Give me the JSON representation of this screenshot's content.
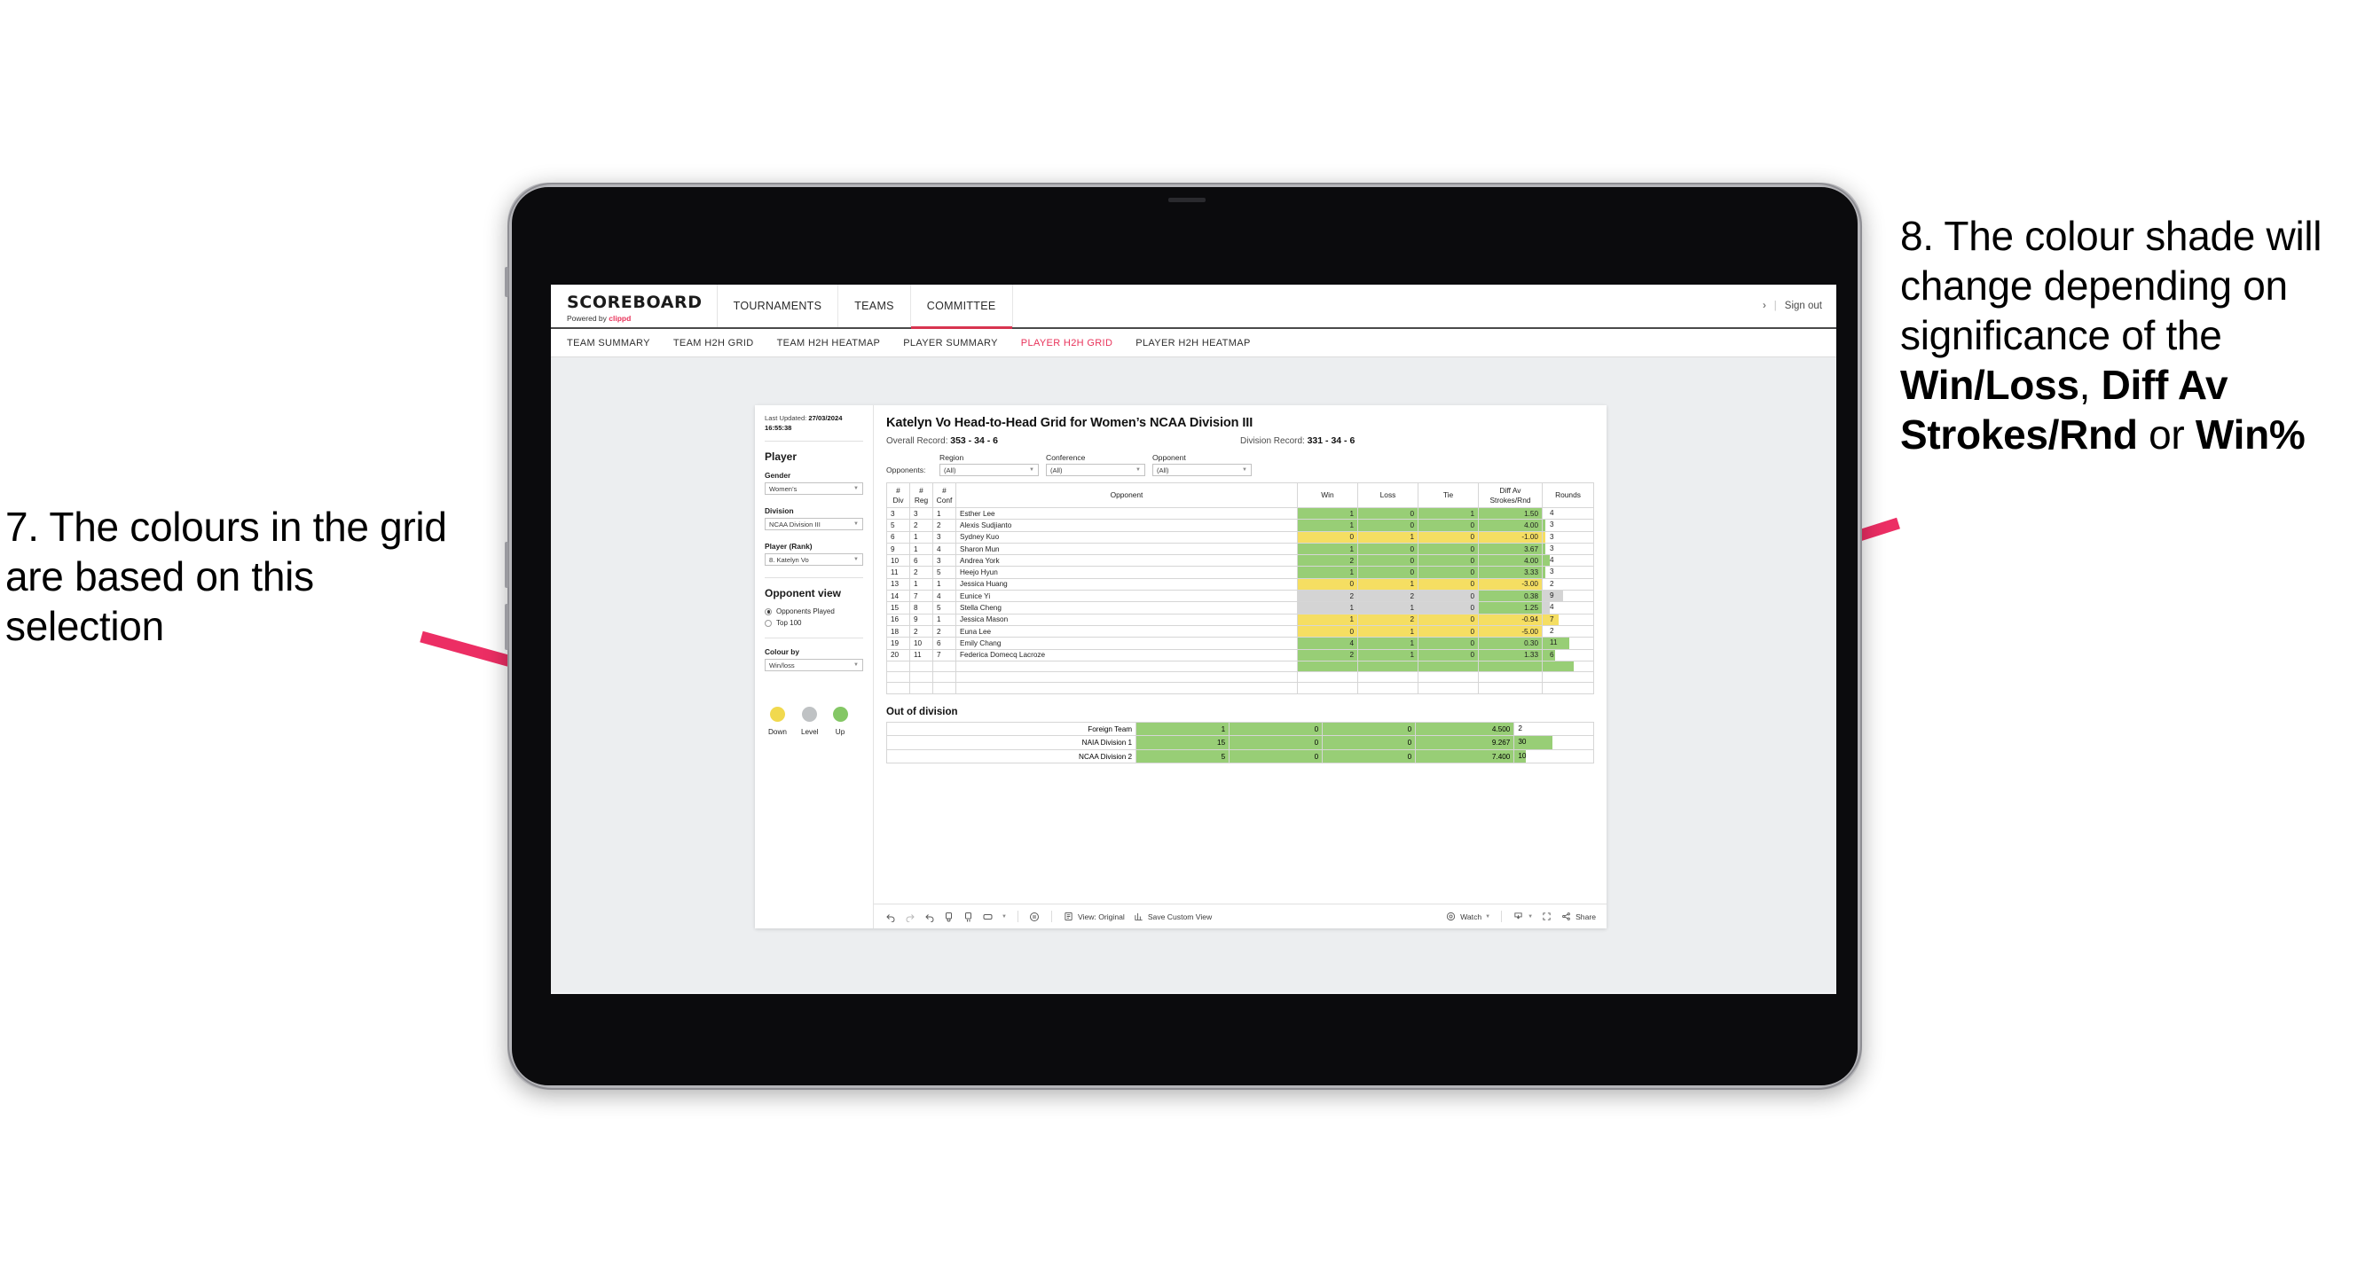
{
  "annotations": {
    "left": "7. The colours in the grid are based on this selection",
    "right_pre": "8. The colour shade will change depending on significance of the ",
    "right_b1": "Win/Loss",
    "right_mid1": ", ",
    "right_b2": "Diff Av Strokes/Rnd",
    "right_mid2": " or ",
    "right_b3": "Win%",
    "arrow_color": "#EC2E64"
  },
  "app": {
    "brand": {
      "logo": "SCOREBOARD",
      "powered_prefix": "Powered by ",
      "powered_name": "clippd"
    },
    "topnav": [
      {
        "label": "TOURNAMENTS",
        "active": false
      },
      {
        "label": "TEAMS",
        "active": false
      },
      {
        "label": "COMMITTEE",
        "active": true
      }
    ],
    "topright": {
      "chevron": "›",
      "divider": "|",
      "signout": "Sign out"
    },
    "subnav": [
      {
        "label": "TEAM SUMMARY",
        "active": false
      },
      {
        "label": "TEAM H2H GRID",
        "active": false
      },
      {
        "label": "TEAM H2H HEATMAP",
        "active": false
      },
      {
        "label": "PLAYER SUMMARY",
        "active": false
      },
      {
        "label": "PLAYER H2H GRID",
        "active": true
      },
      {
        "label": "PLAYER H2H HEATMAP",
        "active": false
      }
    ]
  },
  "sidebar": {
    "last_updated_label": "Last Updated: ",
    "last_updated_value": "27/03/2024 16:55:38",
    "player_heading": "Player",
    "fields": [
      {
        "label": "Gender",
        "value": "Women’s"
      },
      {
        "label": "Division",
        "value": "NCAA Division III"
      },
      {
        "label": "Player (Rank)",
        "value": "8. Katelyn Vo"
      }
    ],
    "opponent_view_heading": "Opponent view",
    "opponent_view_options": [
      {
        "label": "Opponents Played",
        "selected": true
      },
      {
        "label": "Top 100",
        "selected": false
      }
    ],
    "colour_by_label": "Colour by",
    "colour_by_value": "Win/loss",
    "legend": [
      {
        "label": "Down",
        "color": "#F1D94E"
      },
      {
        "label": "Level",
        "color": "#BFC2C4"
      },
      {
        "label": "Up",
        "color": "#84C765"
      }
    ]
  },
  "main": {
    "title": "Katelyn Vo Head-to-Head Grid for Women’s NCAA Division III",
    "overall_record_label": "Overall Record: ",
    "overall_record_value": "353 - 34 - 6",
    "division_record_label": "Division Record: ",
    "division_record_value": "331 - 34 - 6",
    "opponents_label": "Opponents:",
    "filters": [
      {
        "label": "Region",
        "value": "(All)"
      },
      {
        "label": "Conference",
        "value": "(All)"
      },
      {
        "label": "Opponent",
        "value": "(All)"
      }
    ],
    "columns": [
      "# Div",
      "# Reg",
      "# Conf",
      "Opponent",
      "Win",
      "Loss",
      "Tie",
      "Diff Av Strokes/Rnd",
      "Rounds"
    ],
    "columns_split": [
      {
        "l1": "#",
        "l2": "Div"
      },
      {
        "l1": "#",
        "l2": "Reg"
      },
      {
        "l1": "#",
        "l2": "Conf"
      },
      {
        "l1": "Opponent",
        "l2": ""
      },
      {
        "l1": "Win",
        "l2": ""
      },
      {
        "l1": "Loss",
        "l2": ""
      },
      {
        "l1": "Tie",
        "l2": ""
      },
      {
        "l1": "Diff Av",
        "l2": "Strokes/Rnd"
      },
      {
        "l1": "Rounds",
        "l2": ""
      }
    ],
    "rows": [
      {
        "div": "3",
        "reg": "3",
        "conf": "1",
        "opponent": "Esther Lee",
        "win": "1",
        "loss": "0",
        "tie": "1",
        "diff": "1.50",
        "rounds": "4",
        "shade": "g",
        "bar": 0
      },
      {
        "div": "5",
        "reg": "2",
        "conf": "2",
        "opponent": "Alexis Sudjianto",
        "win": "1",
        "loss": "0",
        "tie": "0",
        "diff": "4.00",
        "rounds": "3",
        "shade": "g",
        "bar": 6
      },
      {
        "div": "6",
        "reg": "1",
        "conf": "3",
        "opponent": "Sydney Kuo",
        "win": "0",
        "loss": "1",
        "tie": "0",
        "diff": "-1.00",
        "rounds": "3",
        "shade": "y",
        "bar": 6
      },
      {
        "div": "9",
        "reg": "1",
        "conf": "4",
        "opponent": "Sharon Mun",
        "win": "1",
        "loss": "0",
        "tie": "0",
        "diff": "3.67",
        "rounds": "3",
        "shade": "g",
        "bar": 6
      },
      {
        "div": "10",
        "reg": "6",
        "conf": "3",
        "opponent": "Andrea York",
        "win": "2",
        "loss": "0",
        "tie": "0",
        "diff": "4.00",
        "rounds": "4",
        "shade": "g",
        "bar": 14
      },
      {
        "div": "11",
        "reg": "2",
        "conf": "5",
        "opponent": "Heejo Hyun",
        "win": "1",
        "loss": "0",
        "tie": "0",
        "diff": "3.33",
        "rounds": "3",
        "shade": "g",
        "bar": 6
      },
      {
        "div": "13",
        "reg": "1",
        "conf": "1",
        "opponent": "Jessica Huang",
        "win": "0",
        "loss": "1",
        "tie": "0",
        "diff": "-3.00",
        "rounds": "2",
        "shade": "y",
        "bar": 0
      },
      {
        "div": "14",
        "reg": "7",
        "conf": "4",
        "opponent": "Eunice Yi",
        "win": "2",
        "loss": "2",
        "tie": "0",
        "diff": "0.38",
        "rounds": "9",
        "shade": "gr",
        "bar": 40,
        "diffshade": "g"
      },
      {
        "div": "15",
        "reg": "8",
        "conf": "5",
        "opponent": "Stella Cheng",
        "win": "1",
        "loss": "1",
        "tie": "0",
        "diff": "1.25",
        "rounds": "4",
        "shade": "gr",
        "bar": 14,
        "diffshade": "g"
      },
      {
        "div": "16",
        "reg": "9",
        "conf": "1",
        "opponent": "Jessica Mason",
        "win": "1",
        "loss": "2",
        "tie": "0",
        "diff": "-0.94",
        "rounds": "7",
        "shade": "y",
        "bar": 32
      },
      {
        "div": "18",
        "reg": "2",
        "conf": "2",
        "opponent": "Euna Lee",
        "win": "0",
        "loss": "1",
        "tie": "0",
        "diff": "-5.00",
        "rounds": "2",
        "shade": "y",
        "bar": 0
      },
      {
        "div": "19",
        "reg": "10",
        "conf": "6",
        "opponent": "Emily Chang",
        "win": "4",
        "loss": "1",
        "tie": "0",
        "diff": "0.30",
        "rounds": "11",
        "shade": "g",
        "bar": 52
      },
      {
        "div": "20",
        "reg": "11",
        "conf": "7",
        "opponent": "Federica Domecq Lacroze",
        "win": "2",
        "loss": "1",
        "tie": "0",
        "diff": "1.33",
        "rounds": "6",
        "shade": "g",
        "bar": 24
      }
    ],
    "out_of_division_title": "Out of division",
    "out_of_division_rows": [
      {
        "name": "Foreign Team",
        "win": "1",
        "loss": "0",
        "tie": "0",
        "diff": "4.500",
        "rounds": "2",
        "shade": "g",
        "bar": 0
      },
      {
        "name": "NAIA Division 1",
        "win": "15",
        "loss": "0",
        "tie": "0",
        "diff": "9.267",
        "rounds": "30",
        "shade": "g",
        "bar": 48
      },
      {
        "name": "NCAA Division 2",
        "win": "5",
        "loss": "0",
        "tie": "0",
        "diff": "7.400",
        "rounds": "10",
        "shade": "g",
        "bar": 14
      }
    ]
  },
  "toolbar": {
    "view_label": "View: Original",
    "save_label": "Save Custom View",
    "watch_label": "Watch",
    "share_label": "Share"
  }
}
